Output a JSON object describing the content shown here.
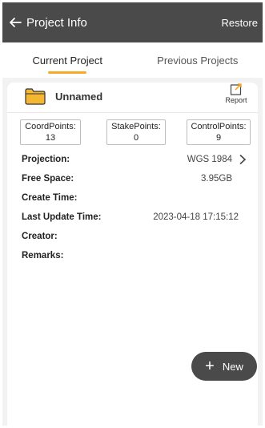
{
  "header": {
    "title": "Project Info",
    "restore_label": "Restore"
  },
  "tabs": [
    {
      "label": "Current Project",
      "active": true
    },
    {
      "label": "Previous Projects",
      "active": false
    }
  ],
  "project": {
    "name": "Unnamed",
    "report_label": "Report"
  },
  "stats": [
    {
      "label": "CoordPoints:",
      "value": "13"
    },
    {
      "label": "StakePoints:",
      "value": "0"
    },
    {
      "label": "ControlPoints:",
      "value": "9"
    }
  ],
  "info": {
    "projection": {
      "label": "Projection:",
      "value": "WGS 1984"
    },
    "free_space": {
      "label": "Free Space:",
      "value": "3.95GB"
    },
    "create_time": {
      "label": "Create Time:",
      "value": ""
    },
    "last_update": {
      "label": "Last Update Time:",
      "value": "2023-04-18 17:15:12"
    },
    "creator": {
      "label": "Creator:",
      "value": ""
    },
    "remarks": {
      "label": "Remarks:",
      "value": ""
    }
  },
  "fab": {
    "label": "New"
  },
  "colors": {
    "titlebar": "#4a4a4a",
    "accent": "#f7a928",
    "folder": "#f5b731"
  },
  "icons": [
    "back-arrow-icon",
    "folder-icon",
    "report-icon",
    "chevron-right-icon",
    "plus-icon"
  ]
}
